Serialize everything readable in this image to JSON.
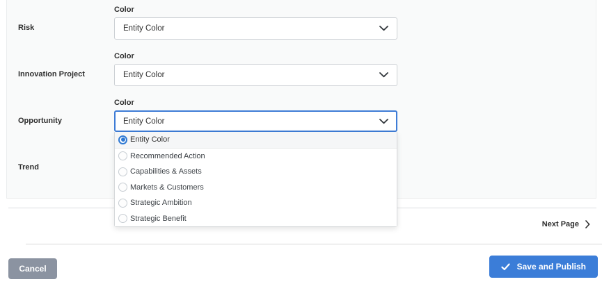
{
  "form": {
    "rows": [
      {
        "entity": "Risk",
        "field_label": "Color",
        "value": "Entity Color"
      },
      {
        "entity": "Innovation Project",
        "field_label": "Color",
        "value": "Entity Color"
      },
      {
        "entity": "Opportunity",
        "field_label": "Color",
        "value": "Entity Color"
      },
      {
        "entity": "Trend"
      }
    ]
  },
  "dropdown": {
    "open_for": "Opportunity",
    "selected": "Entity Color",
    "options": [
      {
        "label": "Entity Color",
        "selected": true
      },
      {
        "label": "Recommended Action",
        "selected": false
      },
      {
        "label": "Capabilities & Assets",
        "selected": false
      },
      {
        "label": "Markets & Customers",
        "selected": false
      },
      {
        "label": "Strategic Ambition",
        "selected": false
      },
      {
        "label": "Strategic Benefit",
        "selected": false
      }
    ]
  },
  "pagination": {
    "next_label": "Next Page"
  },
  "actions": {
    "cancel_label": "Cancel",
    "save_label": "Save and Publish"
  },
  "colors": {
    "accent_blue": "#3b7dd8",
    "focus_border_blue": "#3e7cd6",
    "radio_blue": "#2f79d3",
    "cancel_gray": "#8b93a1",
    "panel_bg": "#f9fafa"
  }
}
